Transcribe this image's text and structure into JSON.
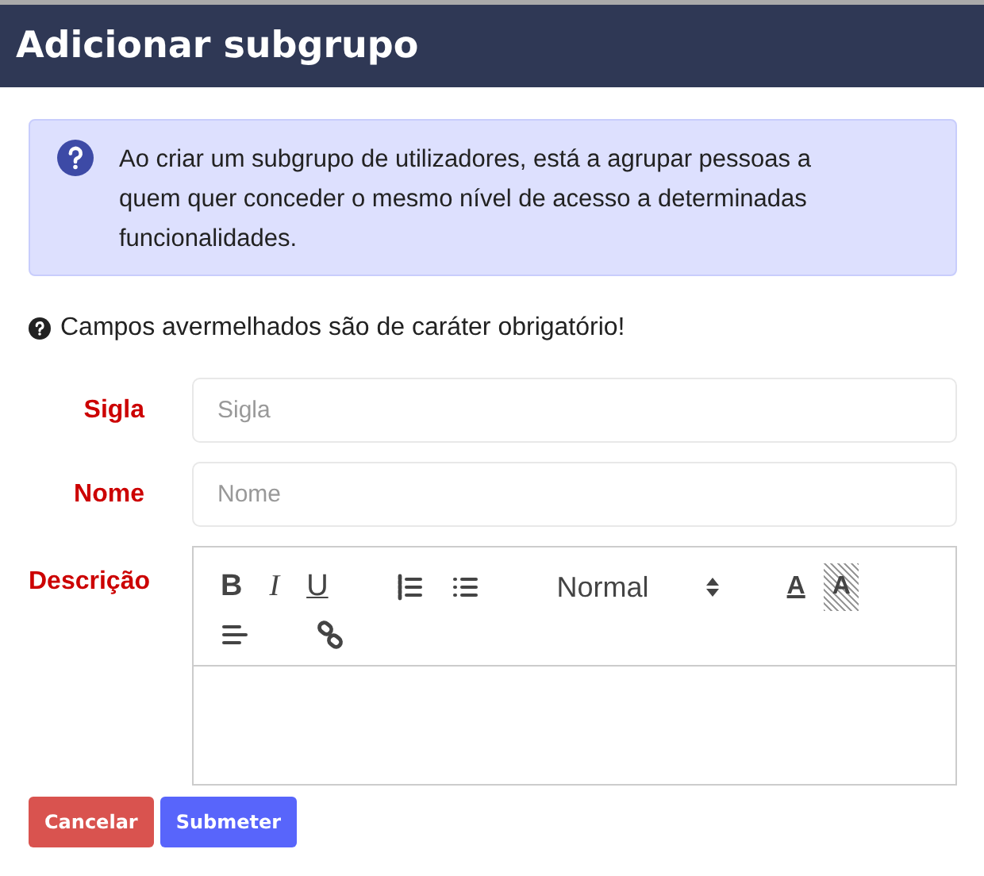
{
  "window": {
    "title": "Adicionar subgrupo"
  },
  "info": {
    "text": "Ao criar um subgrupo de utilizadores, está a agrupar pessoas a quem quer conceder o mesmo nível de acesso a determinadas funcionalidades."
  },
  "required_note": "Campos avermelhados são de caráter obrigatório!",
  "fields": [
    {
      "label": "Sigla",
      "placeholder": "Sigla",
      "required": true
    },
    {
      "label": "Nome",
      "placeholder": "Nome",
      "required": true
    }
  ],
  "editor": {
    "label": "Descrição",
    "required": true,
    "header_value": "Normal",
    "toolbar": [
      {
        "kind": "bold",
        "glyph": "B"
      },
      {
        "kind": "italic",
        "glyph": "I"
      },
      {
        "kind": "underline",
        "glyph": "U"
      },
      {
        "kind": "ordered-list"
      },
      {
        "kind": "bullet-list"
      },
      {
        "kind": "header"
      },
      {
        "kind": "color",
        "glyph": "A"
      },
      {
        "kind": "background",
        "glyph": "A"
      },
      {
        "kind": "align"
      },
      {
        "kind": "link"
      }
    ]
  },
  "buttons": [
    {
      "label": "Cancelar",
      "kind": "danger"
    },
    {
      "label": "Submeter",
      "kind": "primary"
    }
  ]
}
